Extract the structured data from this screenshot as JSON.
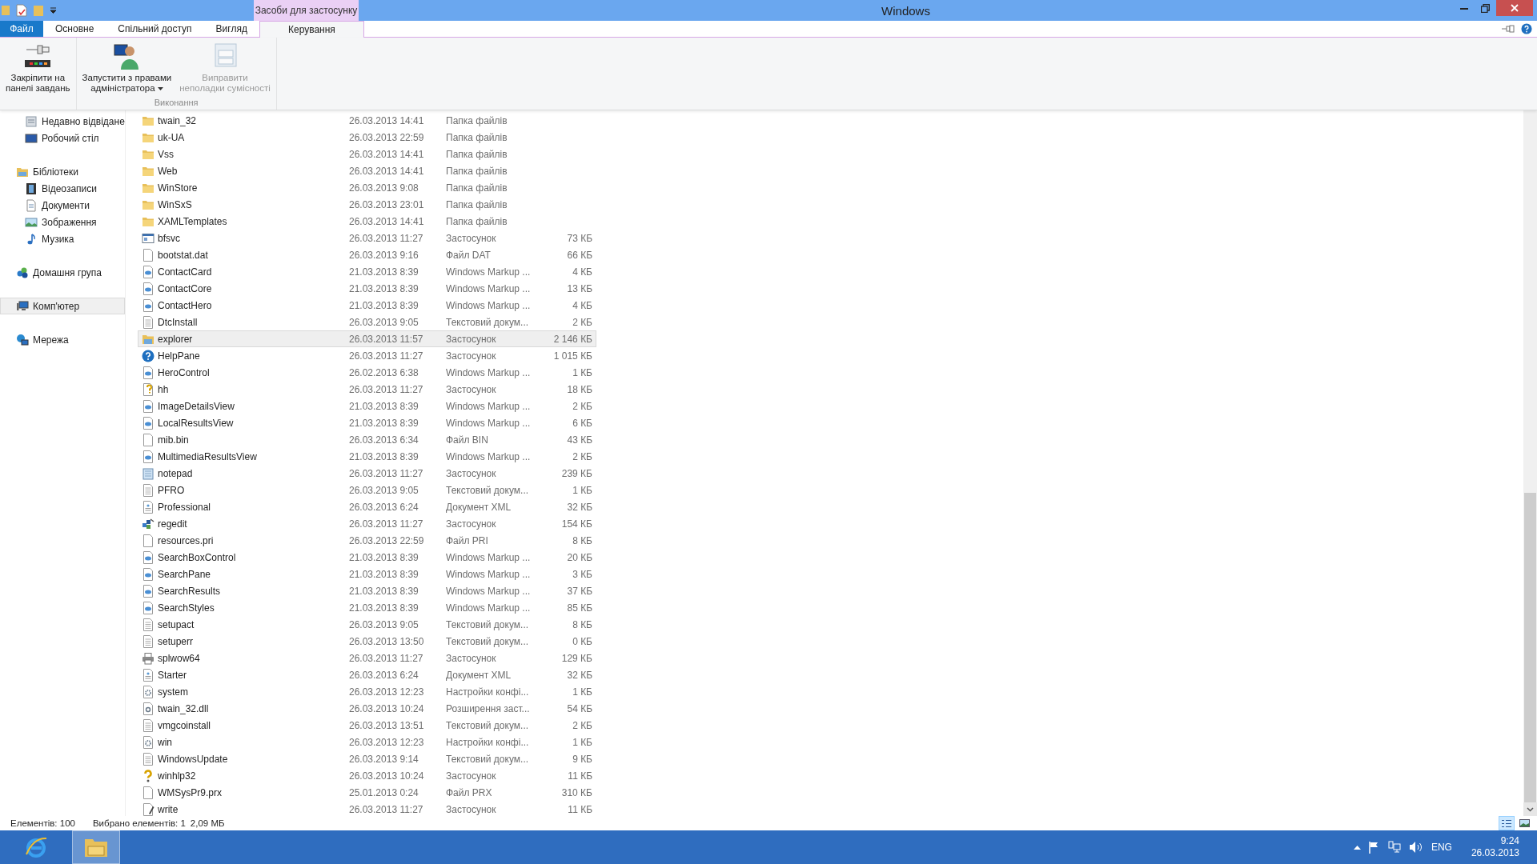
{
  "window": {
    "title": "Windows",
    "context_group": "Засоби для застосунку"
  },
  "tabs": [
    {
      "label": "Файл",
      "kind": "file",
      "selected": false
    },
    {
      "label": "Основне",
      "kind": "tab",
      "selected": false
    },
    {
      "label": "Спільний доступ",
      "kind": "tab",
      "selected": false
    },
    {
      "label": "Вигляд",
      "kind": "tab",
      "selected": false
    },
    {
      "label": "Керування",
      "kind": "context",
      "selected": true
    }
  ],
  "ribbon": {
    "groups": [
      {
        "buttons": [
          {
            "label": "Закріпити на\nпанелі завдань",
            "kind": "pin",
            "disabled": false,
            "has_menu": false
          }
        ]
      },
      {
        "label": "Виконання",
        "buttons": [
          {
            "label": "Запустити з правами\nадміністратора",
            "kind": "admin",
            "disabled": false,
            "has_menu": true
          },
          {
            "label": "Виправити\nнеполадки сумісності",
            "kind": "compat",
            "disabled": true,
            "has_menu": false
          }
        ]
      }
    ]
  },
  "sidebar": {
    "sections": [
      {
        "children": [
          {
            "label": "Недавно відвідане",
            "kind": "recent",
            "selected": false
          },
          {
            "label": "Робочий стіл",
            "kind": "desktop",
            "selected": false
          }
        ]
      },
      {
        "label": "Бібліотеки",
        "kind": "library",
        "selected": false,
        "children": [
          {
            "label": "Відеозаписи",
            "kind": "video",
            "selected": false
          },
          {
            "label": "Документи",
            "kind": "docs",
            "selected": false
          },
          {
            "label": "Зображення",
            "kind": "pictures",
            "selected": false
          },
          {
            "label": "Музика",
            "kind": "music",
            "selected": false
          }
        ]
      },
      {
        "label": "Домашня група",
        "kind": "homegroup",
        "selected": false
      },
      {
        "label": "Комп'ютер",
        "kind": "computer",
        "selected": true
      },
      {
        "label": "Мережа",
        "kind": "network",
        "selected": false
      }
    ]
  },
  "files": [
    {
      "name": "twain_32",
      "date": "26.03.2013 14:41",
      "type": "Папка файлів",
      "kind": "folder",
      "selected": false
    },
    {
      "name": "uk-UA",
      "date": "26.03.2013 22:59",
      "type": "Папка файлів",
      "kind": "folder",
      "selected": false
    },
    {
      "name": "Vss",
      "date": "26.03.2013 14:41",
      "type": "Папка файлів",
      "kind": "folder",
      "selected": false
    },
    {
      "name": "Web",
      "date": "26.03.2013 14:41",
      "type": "Папка файлів",
      "kind": "folder",
      "selected": false
    },
    {
      "name": "WinStore",
      "date": "26.03.2013 9:08",
      "type": "Папка файлів",
      "kind": "folder",
      "selected": false
    },
    {
      "name": "WinSxS",
      "date": "26.03.2013 23:01",
      "type": "Папка файлів",
      "kind": "folder",
      "selected": false
    },
    {
      "name": "XAMLTemplates",
      "date": "26.03.2013 14:41",
      "type": "Папка файлів",
      "kind": "folder",
      "selected": false
    },
    {
      "name": "bfsvc",
      "date": "26.03.2013 11:27",
      "type": "Застосунок",
      "size": "73 КБ",
      "kind": "app",
      "selected": false
    },
    {
      "name": "bootstat.dat",
      "date": "26.03.2013 9:16",
      "type": "Файл DAT",
      "size": "66 КБ",
      "kind": "blank",
      "selected": false
    },
    {
      "name": "ContactCard",
      "date": "21.03.2013 8:39",
      "type": "Windows Markup ...",
      "size": "4 КБ",
      "kind": "markup",
      "selected": false
    },
    {
      "name": "ContactCore",
      "date": "21.03.2013 8:39",
      "type": "Windows Markup ...",
      "size": "13 КБ",
      "kind": "markup",
      "selected": false
    },
    {
      "name": "ContactHero",
      "date": "21.03.2013 8:39",
      "type": "Windows Markup ...",
      "size": "4 КБ",
      "kind": "markup",
      "selected": false
    },
    {
      "name": "DtcInstall",
      "date": "26.03.2013 9:05",
      "type": "Текстовий докум...",
      "size": "2 КБ",
      "kind": "text",
      "selected": false
    },
    {
      "name": "explorer",
      "date": "26.03.2013 11:57",
      "type": "Застосунок",
      "size": "2 146 КБ",
      "kind": "explorer",
      "selected": true
    },
    {
      "name": "HelpPane",
      "date": "26.03.2013 11:27",
      "type": "Застосунок",
      "size": "1 015 КБ",
      "kind": "help",
      "selected": false
    },
    {
      "name": "HeroControl",
      "date": "26.02.2013 6:38",
      "type": "Windows Markup ...",
      "size": "1 КБ",
      "kind": "markup",
      "selected": false
    },
    {
      "name": "hh",
      "date": "26.03.2013 11:27",
      "type": "Застосунок",
      "size": "18 КБ",
      "kind": "question-doc",
      "selected": false
    },
    {
      "name": "ImageDetailsView",
      "date": "21.03.2013 8:39",
      "type": "Windows Markup ...",
      "size": "2 КБ",
      "kind": "markup",
      "selected": false
    },
    {
      "name": "LocalResultsView",
      "date": "21.03.2013 8:39",
      "type": "Windows Markup ...",
      "size": "6 КБ",
      "kind": "markup",
      "selected": false
    },
    {
      "name": "mib.bin",
      "date": "26.03.2013 6:34",
      "type": "Файл BIN",
      "size": "43 КБ",
      "kind": "blank",
      "selected": false
    },
    {
      "name": "MultimediaResultsView",
      "date": "21.03.2013 8:39",
      "type": "Windows Markup ...",
      "size": "2 КБ",
      "kind": "markup",
      "selected": false
    },
    {
      "name": "notepad",
      "date": "26.03.2013 11:27",
      "type": "Застосунок",
      "size": "239 КБ",
      "kind": "notepad",
      "selected": false
    },
    {
      "name": "PFRO",
      "date": "26.03.2013 9:05",
      "type": "Текстовий докум...",
      "size": "1 КБ",
      "kind": "text",
      "selected": false
    },
    {
      "name": "Professional",
      "date": "26.03.2013 6:24",
      "type": "Документ XML",
      "size": "32 КБ",
      "kind": "xml",
      "selected": false
    },
    {
      "name": "regedit",
      "date": "26.03.2013 11:27",
      "type": "Застосунок",
      "size": "154 КБ",
      "kind": "regedit",
      "selected": false
    },
    {
      "name": "resources.pri",
      "date": "26.03.2013 22:59",
      "type": "Файл PRI",
      "size": "8 КБ",
      "kind": "blank",
      "selected": false
    },
    {
      "name": "SearchBoxControl",
      "date": "21.03.2013 8:39",
      "type": "Windows Markup ...",
      "size": "20 КБ",
      "kind": "markup",
      "selected": false
    },
    {
      "name": "SearchPane",
      "date": "21.03.2013 8:39",
      "type": "Windows Markup ...",
      "size": "3 КБ",
      "kind": "markup",
      "selected": false
    },
    {
      "name": "SearchResults",
      "date": "21.03.2013 8:39",
      "type": "Windows Markup ...",
      "size": "37 КБ",
      "kind": "markup",
      "selected": false
    },
    {
      "name": "SearchStyles",
      "date": "21.03.2013 8:39",
      "type": "Windows Markup ...",
      "size": "85 КБ",
      "kind": "markup",
      "selected": false
    },
    {
      "name": "setupact",
      "date": "26.03.2013 9:05",
      "type": "Текстовий докум...",
      "size": "8 КБ",
      "kind": "text",
      "selected": false
    },
    {
      "name": "setuperr",
      "date": "26.03.2013 13:50",
      "type": "Текстовий докум...",
      "size": "0 КБ",
      "kind": "text",
      "selected": false
    },
    {
      "name": "splwow64",
      "date": "26.03.2013 11:27",
      "type": "Застосунок",
      "size": "129 КБ",
      "kind": "printer",
      "selected": false
    },
    {
      "name": "Starter",
      "date": "26.03.2013 6:24",
      "type": "Документ XML",
      "size": "32 КБ",
      "kind": "xml",
      "selected": false
    },
    {
      "name": "system",
      "date": "26.03.2013 12:23",
      "type": "Настройки конфі...",
      "size": "1 КБ",
      "kind": "config",
      "selected": false
    },
    {
      "name": "twain_32.dll",
      "date": "26.03.2013 10:24",
      "type": "Розширення заст...",
      "size": "54 КБ",
      "kind": "dll",
      "selected": false
    },
    {
      "name": "vmgcoinstall",
      "date": "26.03.2013 13:51",
      "type": "Текстовий докум...",
      "size": "2 КБ",
      "kind": "text",
      "selected": false
    },
    {
      "name": "win",
      "date": "26.03.2013 12:23",
      "type": "Настройки конфі...",
      "size": "1 КБ",
      "kind": "config",
      "selected": false
    },
    {
      "name": "WindowsUpdate",
      "date": "26.03.2013 9:14",
      "type": "Текстовий докум...",
      "size": "9 КБ",
      "kind": "text",
      "selected": false
    },
    {
      "name": "winhlp32",
      "date": "26.03.2013 10:24",
      "type": "Застосунок",
      "size": "11 КБ",
      "kind": "question",
      "selected": false
    },
    {
      "name": "WMSysPr9.prx",
      "date": "25.01.2013 0:24",
      "type": "Файл PRX",
      "size": "310 КБ",
      "kind": "blank",
      "selected": false
    },
    {
      "name": "write",
      "date": "26.03.2013 11:27",
      "type": "Застосунок",
      "size": "11 КБ",
      "kind": "write",
      "selected": false
    }
  ],
  "status_bar": {
    "items_count": "Елементів: 100",
    "selection": "Вибрано елементів: 1",
    "selection_size": "2,09 МБ",
    "views": [
      {
        "kind": "details",
        "selected": true
      },
      {
        "kind": "tiles",
        "selected": false
      }
    ]
  },
  "taskbar": {
    "apps": [
      {
        "kind": "browser",
        "selected": false
      },
      {
        "kind": "explorer",
        "selected": true
      }
    ],
    "language": "ENG",
    "time": "9:24",
    "date": "26.03.2013"
  }
}
